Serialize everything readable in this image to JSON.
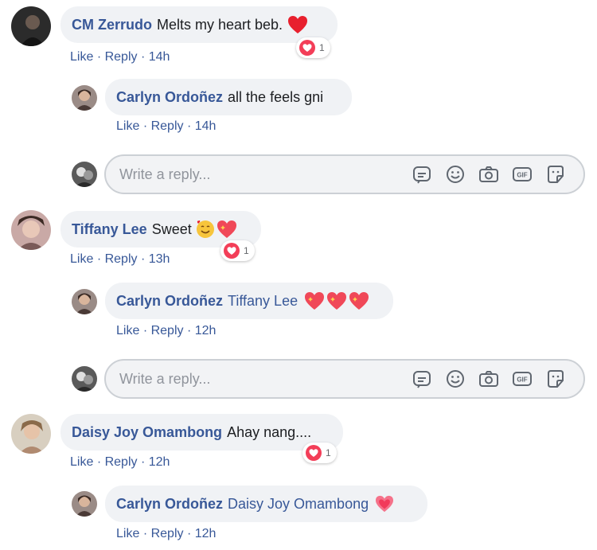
{
  "threads": [
    {
      "comment": {
        "author": "CM Zerrudo",
        "text": "Melts my heart beb.",
        "reaction_count": "1",
        "like": "Like",
        "reply": "Reply",
        "time": "14h"
      },
      "reply": {
        "author": "Carlyn Ordoñez",
        "text": "all the feels gni",
        "like": "Like",
        "reply": "Reply",
        "time": "14h"
      },
      "reply_box": {
        "placeholder": "Write a reply..."
      }
    },
    {
      "comment": {
        "author": "Tiffany Lee",
        "text": "Sweet",
        "reaction_count": "1",
        "like": "Like",
        "reply": "Reply",
        "time": "13h"
      },
      "reply": {
        "author": "Carlyn Ordoñez",
        "text": "Tiffany Lee",
        "like": "Like",
        "reply": "Reply",
        "time": "12h"
      },
      "reply_box": {
        "placeholder": "Write a reply..."
      }
    },
    {
      "comment": {
        "author": "Daisy Joy Omambong",
        "text": "Ahay nang....",
        "reaction_count": "1",
        "like": "Like",
        "reply": "Reply",
        "time": "12h"
      },
      "reply": {
        "author": "Carlyn Ordoñez",
        "text": "Daisy Joy Omambong",
        "like": "Like",
        "reply": "Reply",
        "time": "12h"
      }
    }
  ],
  "separator": "·",
  "icons": {
    "reaction": "love-reaction-icon",
    "reply_box": [
      "sticker-icon",
      "emoji-icon",
      "camera-icon",
      "gif-icon",
      "sticker-face-icon"
    ]
  },
  "colors": {
    "link": "#385898",
    "bubble": "#f0f2f5",
    "love": "#f33e58"
  }
}
